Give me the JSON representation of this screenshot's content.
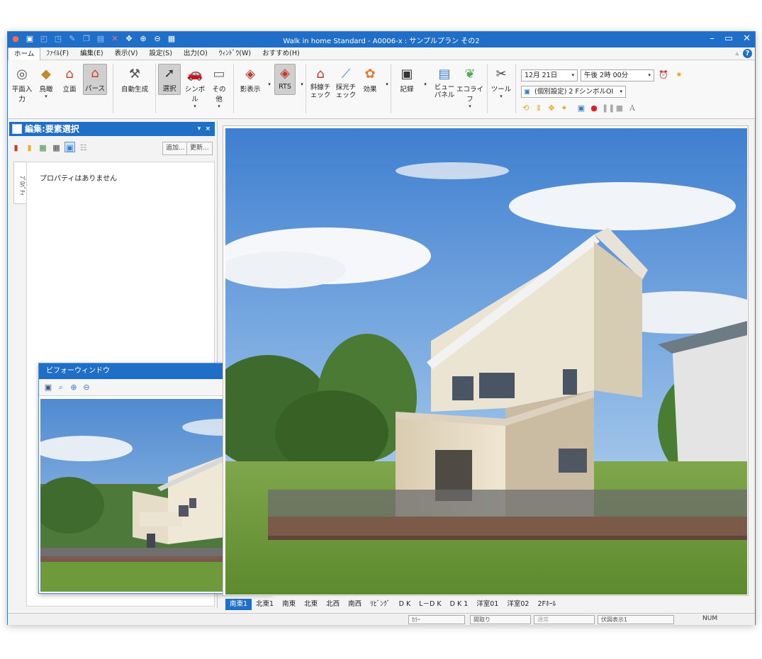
{
  "window": {
    "title": "Walk in home Standard - A0006-x : サンプルプラン その2",
    "min": "–",
    "max": "▭",
    "close": "✕"
  },
  "menu": {
    "items": [
      "ホーム",
      "ﾌｧｲﾙ(F)",
      "編集(E)",
      "表示(V)",
      "設定(S)",
      "出力(O)",
      "ｳｨﾝﾄﾞｳ(W)",
      "おすすめ(H)"
    ]
  },
  "ribbon": {
    "buttons": [
      {
        "label": "平面入力",
        "icon": "mouse-icon"
      },
      {
        "label": "鳥瞰",
        "icon": "birdseye-icon"
      },
      {
        "label": "立面",
        "icon": "elevation-icon"
      },
      {
        "label": "パース",
        "icon": "perspective-icon"
      },
      {
        "label": "自動生成",
        "icon": "auto-generate-icon"
      },
      {
        "label": "選択",
        "icon": "select-cursor-icon"
      },
      {
        "label": "シンボル",
        "icon": "symbol-icon"
      },
      {
        "label": "その他",
        "icon": "other-icon"
      },
      {
        "label": "影表示",
        "icon": "shadow-icon"
      },
      {
        "label": "RTS",
        "icon": "rts-icon"
      },
      {
        "label": "斜線チェック",
        "icon": "slant-check-icon"
      },
      {
        "label": "採光チェック",
        "icon": "daylight-check-icon"
      },
      {
        "label": "効果",
        "icon": "effect-icon"
      },
      {
        "label": "記録",
        "icon": "camera-icon"
      },
      {
        "label": "ビューパネル",
        "icon": "view-panel-icon"
      },
      {
        "label": "エコライフ",
        "icon": "ecolife-icon"
      },
      {
        "label": "ツール",
        "icon": "tools-icon"
      }
    ],
    "date": "12月 21日",
    "time": "午後 2時 00分",
    "setting": "(個別設定) 2 FシンボルOI"
  },
  "left_panel": {
    "title": "編集:要素選択",
    "add_button": "追加...",
    "update_button": "更新...",
    "vertical_tab": "ﾌﾟﾛﾊﾟﾃｨ",
    "empty_message": "プロパティはありません"
  },
  "before_window": {
    "title": "ビフォーウィンドウ",
    "close": "✕"
  },
  "view_tabs": [
    "南東1",
    "北東1",
    "南東",
    "北東",
    "北西",
    "南西",
    "ﾘﾋﾞﾝｸﾞ",
    "D K",
    "L－D K",
    "D K 1",
    "洋室01",
    "洋室02",
    "2Fﾎｰﾙ"
  ],
  "status": {
    "color": "ｶﾗｰ",
    "layout": "間取り",
    "normal": "通常",
    "plan_view": "伏図表示1",
    "num": "NUM"
  },
  "colors": {
    "accent": "#1f6fc9",
    "tab_active": "#1f6fc9"
  }
}
